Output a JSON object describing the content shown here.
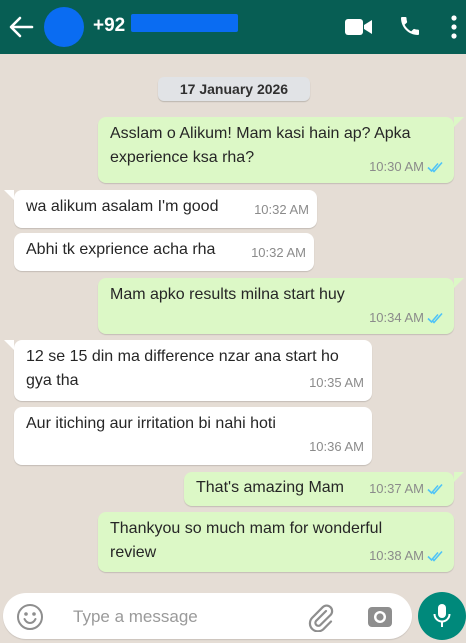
{
  "header": {
    "contact_prefix": "+92",
    "colors": {
      "bar": "#075e54",
      "redaction": "#0a6cf2"
    },
    "icons": [
      "back-arrow-icon",
      "video-call-icon",
      "phone-icon",
      "more-options-icon"
    ]
  },
  "chat": {
    "date": "17 January 2026",
    "messages": [
      {
        "dir": "out",
        "text": "Asslam o Alikum! Mam kasi hain ap? Apka experience ksa rha?",
        "time": "10:30 AM"
      },
      {
        "dir": "in",
        "text": "wa alikum asalam I'm good",
        "time": "10:32 AM"
      },
      {
        "dir": "in",
        "text": "Abhi tk exprience acha rha",
        "time": "10:32 AM"
      },
      {
        "dir": "out",
        "text": "Mam apko results milna start huy",
        "time": "10:34 AM"
      },
      {
        "dir": "in",
        "text": "12 se 15 din ma difference nzar ana start ho gya tha",
        "time": "10:35 AM"
      },
      {
        "dir": "in",
        "text": "Aur itiching aur irritation bi nahi hoti",
        "time": "10:36 AM"
      },
      {
        "dir": "out",
        "text": "That's amazing Mam",
        "time": "10:37 AM"
      },
      {
        "dir": "out",
        "text": "Thankyou so much mam for wonderful review",
        "time": "10:38 AM"
      }
    ],
    "colors": {
      "outgoing": "#dcf8c6",
      "incoming": "#ffffff",
      "read_ticks": "#4fc3f7"
    }
  },
  "composer": {
    "placeholder": "Type a message",
    "icons": [
      "emoji-icon",
      "attach-icon",
      "camera-icon",
      "mic-icon"
    ],
    "colors": {
      "mic_button": "#00897b"
    }
  }
}
